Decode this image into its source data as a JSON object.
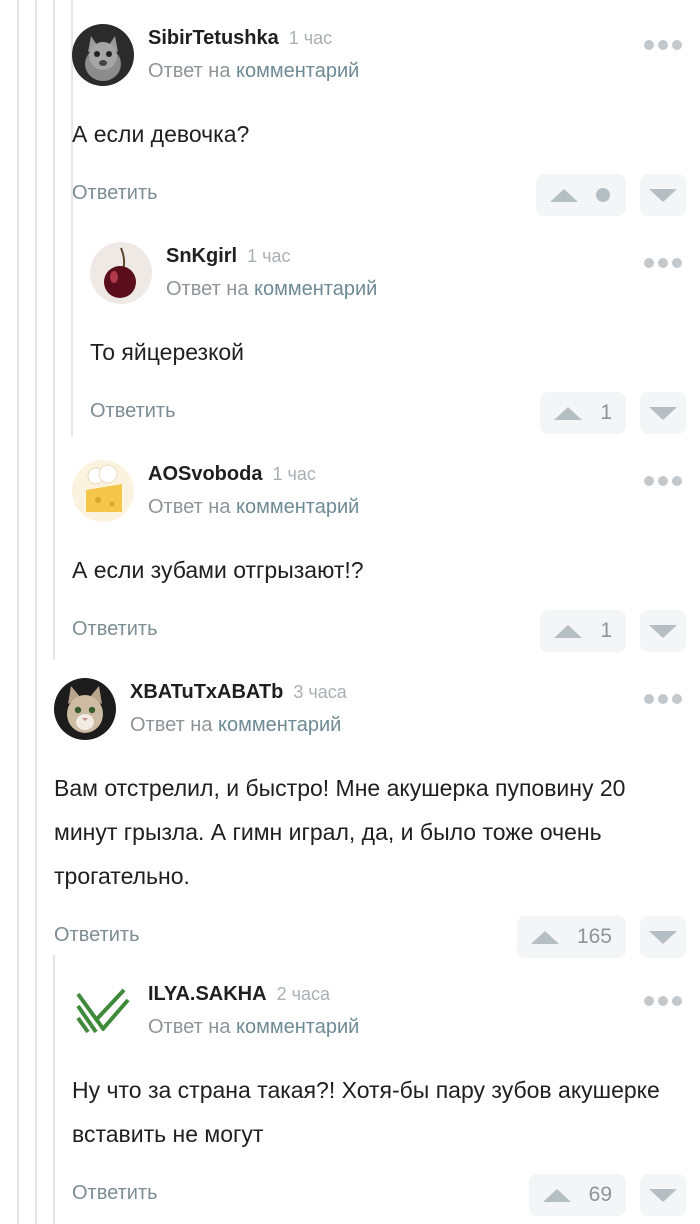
{
  "comments": [
    {
      "author": "SibirTetushka",
      "time": "1 час",
      "reply_prefix": "Ответ на",
      "reply_link": "комментарий",
      "text": "А если девочка?",
      "reply_label": "Ответить",
      "rating": "",
      "rating_indicator": "dot",
      "avatar": "cat-kitten-avatar"
    },
    {
      "author": "SnKgirl",
      "time": "1 час",
      "reply_prefix": "Ответ на",
      "reply_link": "комментарий",
      "text": "То яйцерезкой",
      "reply_label": "Ответить",
      "rating": "1",
      "avatar": "cherry-avatar"
    },
    {
      "author": "AOSvoboda",
      "time": "1 час",
      "reply_prefix": "Ответ на",
      "reply_link": "комментарий",
      "text": "А если зубами отгрызают!?",
      "reply_label": "Ответить",
      "rating": "1",
      "avatar": "cheese-chef-avatar"
    },
    {
      "author": "XBATuTxABATb",
      "time": "3 часа",
      "reply_prefix": "Ответ на",
      "reply_link": "комментарий",
      "text": "Вам отстрелил, и быстро! Мне акушерка пуповину 20 минут грызла. А гимн играл, да, и было тоже очень трогательно.",
      "reply_label": "Ответить",
      "rating": "165",
      "avatar": "cat-face-avatar"
    },
    {
      "author": "ILYA.SAKHA",
      "time": "2 часа",
      "reply_prefix": "Ответ на",
      "reply_link": "комментарий",
      "text": "Ну что за страна такая?! Хотя-бы пару зубов акушерке вставить не могут",
      "reply_label": "Ответить",
      "rating": "69",
      "avatar": "green-stripes-avatar"
    }
  ],
  "colors": {
    "accent_link": "#6e8a95",
    "muted": "#8d9599",
    "thread_line": "#e3e6e8",
    "rating_bg": "#f4f5f6"
  }
}
